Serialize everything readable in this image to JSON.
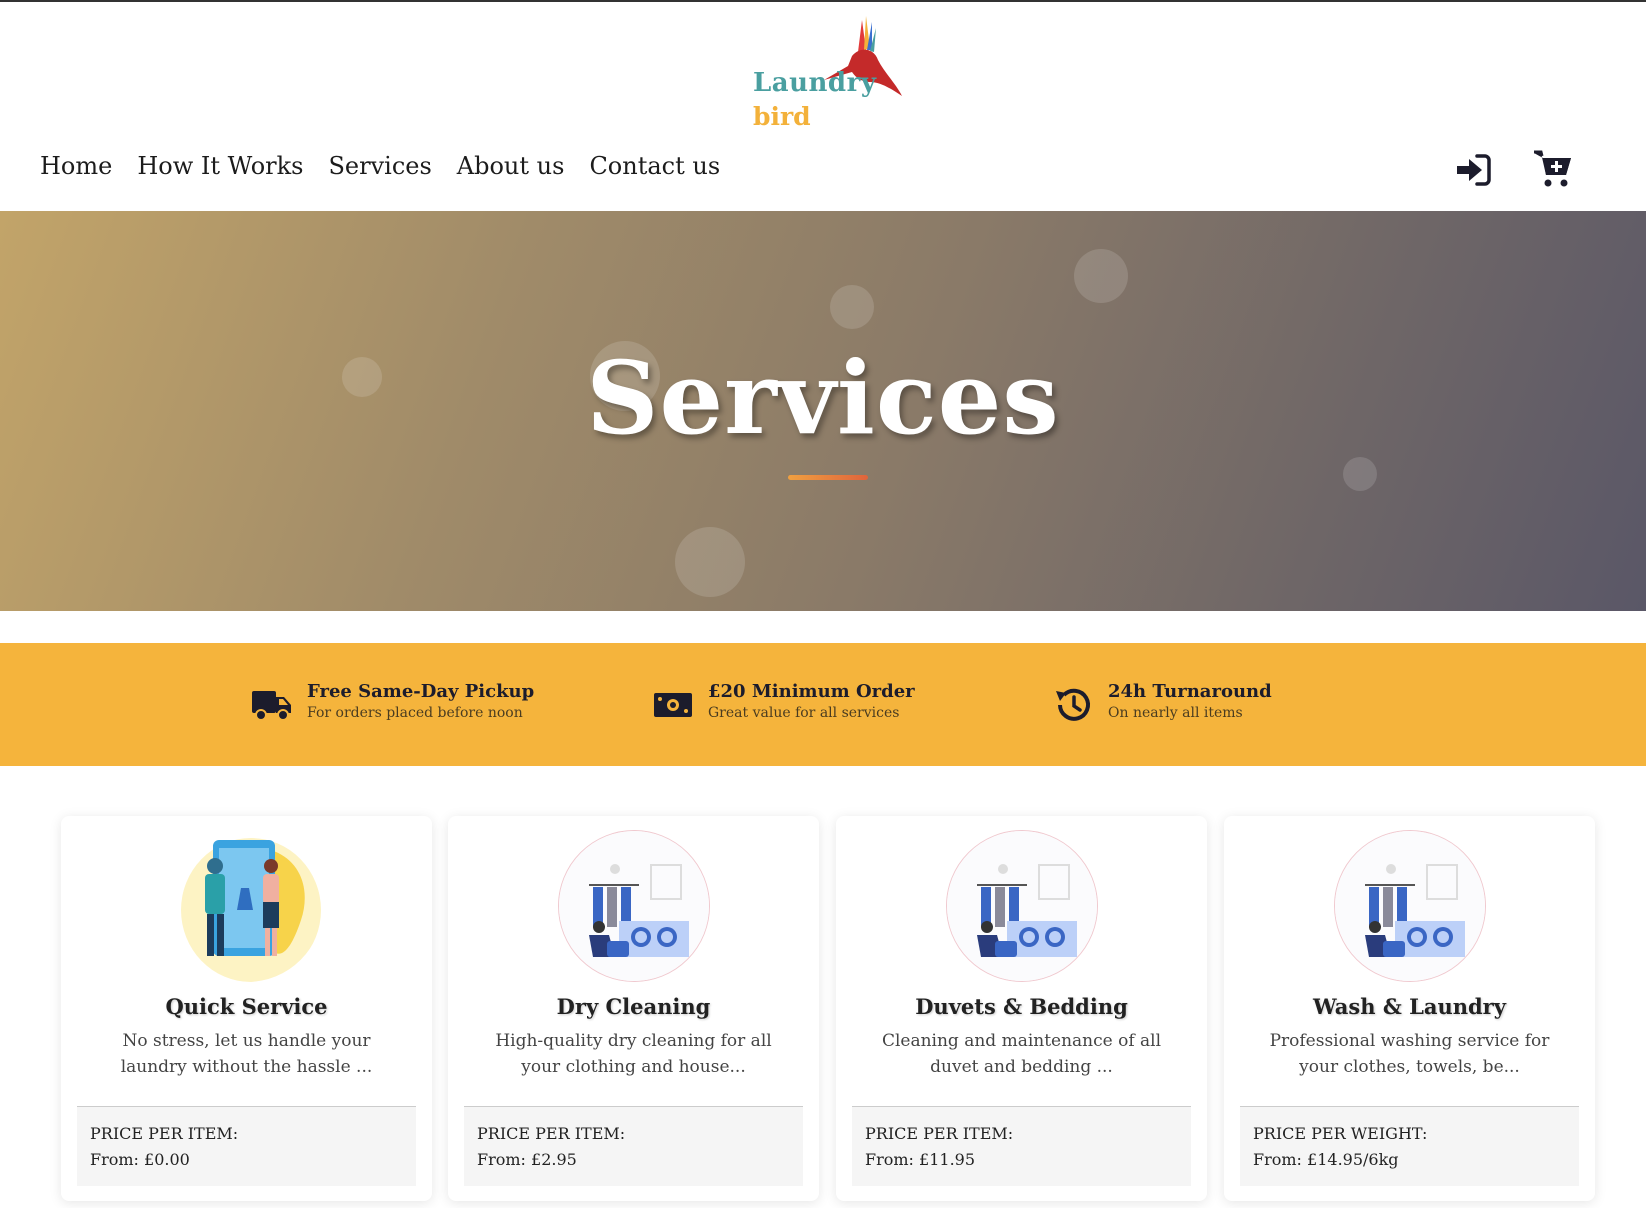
{
  "logo": {
    "word1": "Laundry",
    "word2": "bird"
  },
  "nav": {
    "items": [
      {
        "label": "Home"
      },
      {
        "label": "How It Works"
      },
      {
        "label": "Services"
      },
      {
        "label": "About us"
      },
      {
        "label": "Contact us"
      }
    ],
    "login_icon": "sign-in-icon",
    "cart_icon": "cart-plus-icon"
  },
  "hero": {
    "title": "Services"
  },
  "features": [
    {
      "icon": "truck-icon",
      "title": "Free Same-Day Pickup",
      "subtitle": "For orders placed before noon"
    },
    {
      "icon": "money-bill-icon",
      "title": "£20 Minimum Order",
      "subtitle": "Great value for all services"
    },
    {
      "icon": "history-icon",
      "title": "24h Turnaround",
      "subtitle": "On nearly all items"
    }
  ],
  "services": [
    {
      "title": "Quick Service",
      "description": "No stress, let us handle your laundry without the hassle ...",
      "price_label": "PRICE PER ITEM:",
      "price": "From: £0.00"
    },
    {
      "title": "Dry Cleaning",
      "description": "High-quality dry cleaning for all your clothing and house...",
      "price_label": "PRICE PER ITEM:",
      "price": "From: £2.95"
    },
    {
      "title": "Duvets & Bedding",
      "description": "Cleaning and maintenance of all duvet and bedding ...",
      "price_label": "PRICE PER ITEM:",
      "price": "From: £11.95"
    },
    {
      "title": "Wash & Laundry",
      "description": "Professional washing service for your clothes, towels, be...",
      "price_label": "PRICE PER WEIGHT:",
      "price": "From: £14.95/6kg"
    }
  ],
  "colors": {
    "accent": "#f5b43c",
    "logo_teal": "#4a9fa0",
    "logo_orange": "#f3b13a",
    "dark": "#1c1c2c"
  }
}
